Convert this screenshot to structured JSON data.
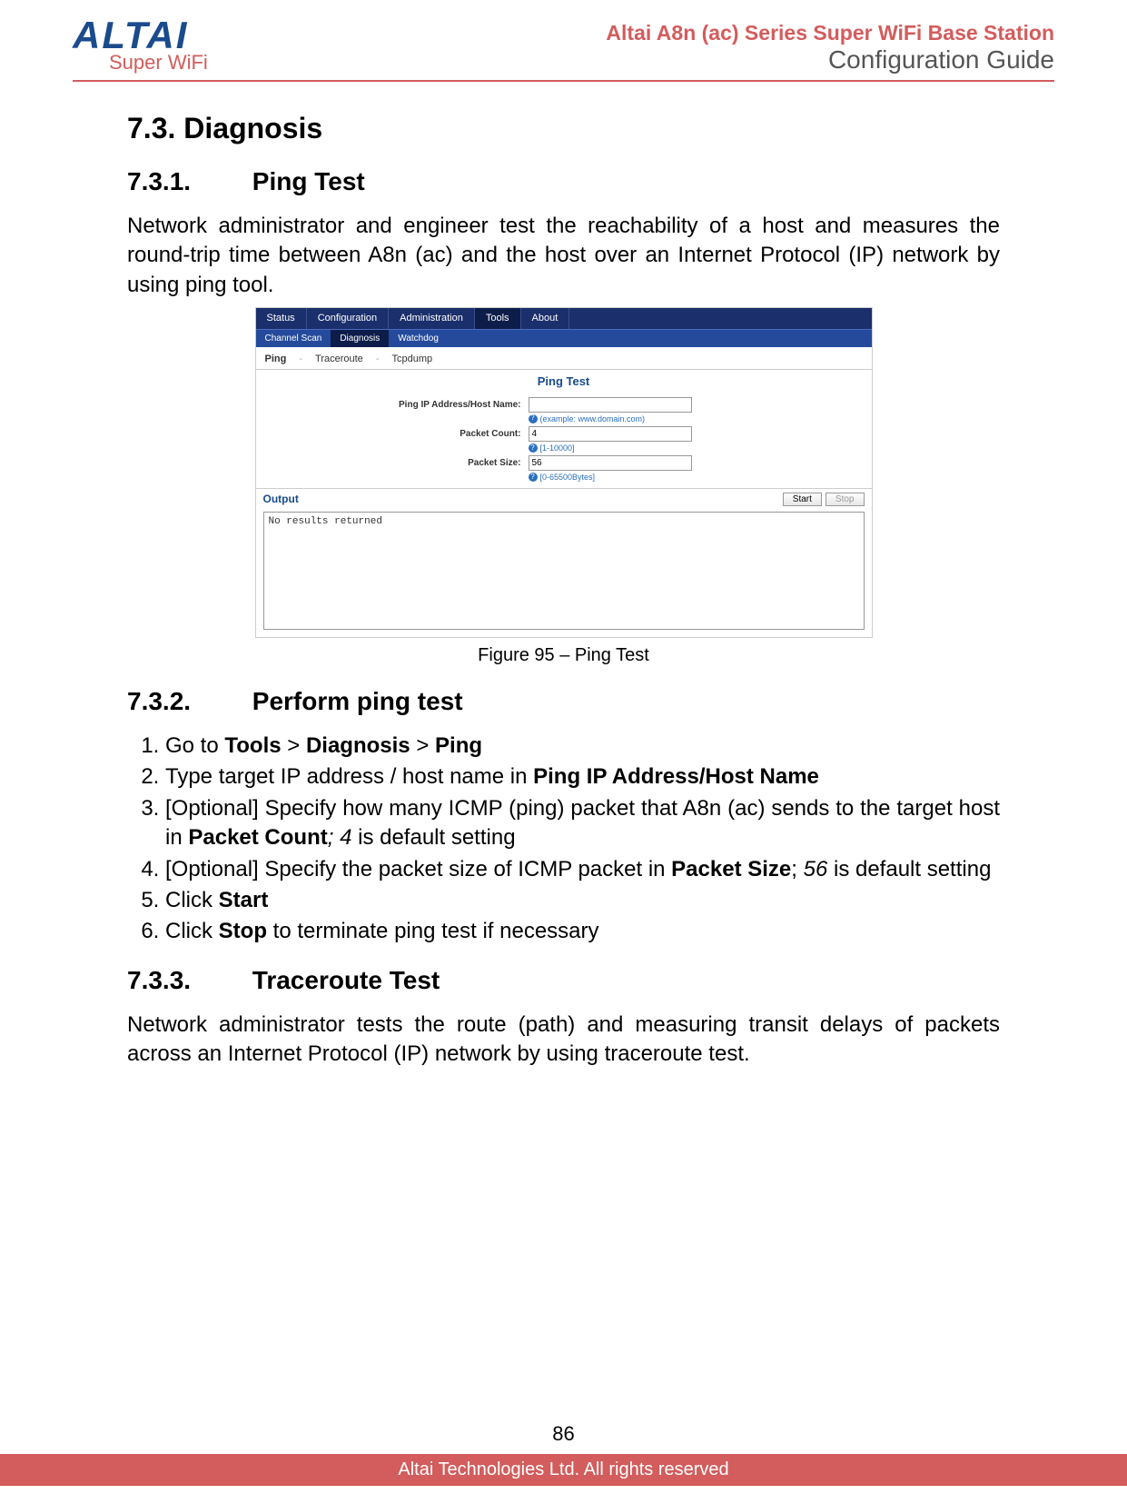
{
  "header": {
    "logo_main": "ALTAI",
    "logo_sub": "Super WiFi",
    "title1": "Altai A8n (ac) Series Super WiFi Base Station",
    "title2": "Configuration Guide"
  },
  "sections": {
    "s73": {
      "num": "7.3.",
      "title": "Diagnosis"
    },
    "s731": {
      "num": "7.3.1.",
      "title": "Ping Test"
    },
    "s731_para": "Network administrator and engineer test the reachability of a host and measures the round-trip time between A8n (ac) and the host over an Internet Protocol (IP) network by using ping tool.",
    "fig95": "Figure 95 – Ping Test",
    "s732": {
      "num": "7.3.2.",
      "title": "Perform ping test"
    },
    "steps": {
      "s1_a": "Go to ",
      "s1_b": "Tools",
      "s1_c": " > ",
      "s1_d": "Diagnosis",
      "s1_e": " > ",
      "s1_f": "Ping",
      "s2_a": "Type target IP address / host name in ",
      "s2_b": "Ping IP Address/Host Name",
      "s3_a": "[Optional] Specify how many ICMP (ping) packet that A8n (ac) sends to the target host in ",
      "s3_b": "Packet Count",
      "s3_c": "; ",
      "s3_d": "4",
      "s3_e": " is default setting",
      "s4_a": "[Optional] Specify the packet size of ICMP packet in ",
      "s4_b": "Packet Size",
      "s4_c": "; ",
      "s4_d": "56",
      "s4_e": " is default setting",
      "s5_a": "Click ",
      "s5_b": "Start",
      "s6_a": "Click ",
      "s6_b": "Stop",
      "s6_c": " to terminate ping test if necessary"
    },
    "s733": {
      "num": "7.3.3.",
      "title": "Traceroute Test"
    },
    "s733_para": "Network administrator tests the route (path) and measuring transit delays of packets across an Internet Protocol (IP) network by using traceroute test."
  },
  "screenshot": {
    "top_tabs": [
      "Status",
      "Configuration",
      "Administration",
      "Tools",
      "About"
    ],
    "top_active": "Tools",
    "sub_tabs": [
      "Channel Scan",
      "Diagnosis",
      "Watchdog"
    ],
    "sub_active": "Diagnosis",
    "tool_tabs": [
      "Ping",
      "Traceroute",
      "Tcpdump"
    ],
    "tool_active": "Ping",
    "panel_title": "Ping Test",
    "fields": {
      "ip": {
        "label": "Ping IP Address/Host Name:",
        "value": "",
        "hint": "(example: www.domain.com)"
      },
      "count": {
        "label": "Packet Count:",
        "value": "4",
        "hint": "[1-10000]"
      },
      "size": {
        "label": "Packet Size:",
        "value": "56",
        "hint": "[0-65500Bytes]"
      }
    },
    "output_label": "Output",
    "start_btn": "Start",
    "stop_btn": "Stop",
    "output_text": "No results returned"
  },
  "footer": {
    "page_num": "86",
    "copyright": "Altai Technologies Ltd. All rights reserved"
  }
}
